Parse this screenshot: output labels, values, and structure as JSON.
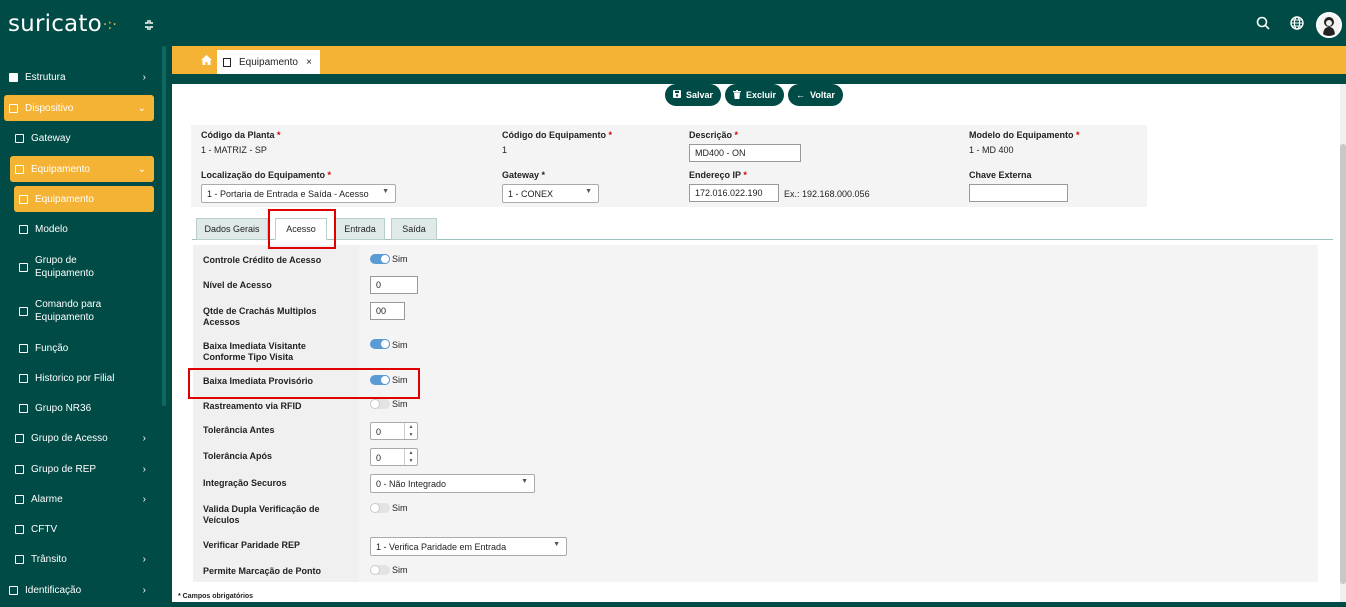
{
  "app": {
    "logo": "suricato",
    "logo_dots": "·:·"
  },
  "sidebar": {
    "items": [
      {
        "label": "Estrutura"
      },
      {
        "label": "Dispositivo"
      },
      {
        "label": "Gateway"
      },
      {
        "label": "Equipamento"
      },
      {
        "label": "Equipamento"
      },
      {
        "label": "Modelo"
      },
      {
        "label": "Grupo de Equipamento"
      },
      {
        "label": "Comando para Equipamento"
      },
      {
        "label": "Função"
      },
      {
        "label": "Historico por Filial"
      },
      {
        "label": "Grupo NR36"
      },
      {
        "label": "Grupo de Acesso"
      },
      {
        "label": "Grupo de REP"
      },
      {
        "label": "Alarme"
      },
      {
        "label": "CFTV"
      },
      {
        "label": "Trânsito"
      },
      {
        "label": "Identificação"
      }
    ]
  },
  "tabbar": {
    "tab_label": "Equipamento",
    "close": "×"
  },
  "toolbar": {
    "save": "Salvar",
    "delete": "Excluir",
    "back": "Voltar"
  },
  "form": {
    "codigo_planta": {
      "label": "Código da Planta",
      "value": "1 - MATRIZ - SP"
    },
    "codigo_equipamento": {
      "label": "Código do Equipamento",
      "value": "1"
    },
    "descricao": {
      "label": "Descrição",
      "value": "MD400 - ON"
    },
    "modelo": {
      "label": "Modelo do Equipamento",
      "value": "1 - MD 400"
    },
    "localizacao": {
      "label": "Localização do Equipamento",
      "value": "1 - Portaria de Entrada e Saída - Acesso"
    },
    "gateway": {
      "label": "Gateway",
      "value": "1 - CONEX"
    },
    "endereco_ip": {
      "label": "Endereço IP",
      "value": "172.016.022.190",
      "hint": "Ex.: 192.168.000.056"
    },
    "chave_externa": {
      "label": "Chave Externa",
      "value": ""
    },
    "required_mark": "*"
  },
  "tabs": [
    {
      "label": "Dados Gerais"
    },
    {
      "label": "Acesso"
    },
    {
      "label": "Entrada"
    },
    {
      "label": "Saída"
    }
  ],
  "acesso": {
    "controle_credito": {
      "label": "Controle Crédito de Acesso",
      "toggle": "Sim",
      "on": true
    },
    "nivel_acesso": {
      "label": "Nível de Acesso",
      "value": "0"
    },
    "qtde_crachas": {
      "label": "Qtde de Crachás Multiplos Acessos",
      "value": "00"
    },
    "baixa_visitante": {
      "label": "Baixa Imediata Visitante Conforme Tipo Visita",
      "toggle": "Sim",
      "on": true
    },
    "baixa_provisorio": {
      "label": "Baixa Imediata Provisório",
      "toggle": "Sim",
      "on": true
    },
    "rastreamento_rfid": {
      "label": "Rastreamento via RFID",
      "toggle": "Sim",
      "on": false
    },
    "tolerancia_antes": {
      "label": "Tolerância Antes",
      "value": "0"
    },
    "tolerancia_apos": {
      "label": "Tolerância Após",
      "value": "0"
    },
    "integracao_securos": {
      "label": "Integração Securos",
      "value": "0 - Não Integrado"
    },
    "valida_dupla": {
      "label": "Valida Dupla Verificação de Veículos",
      "toggle": "Sim",
      "on": false
    },
    "verificar_paridade": {
      "label": "Verificar Paridade REP",
      "value": "1 - Verifica Paridade em Entrada"
    },
    "permite_marcacao": {
      "label": "Permite Marcação de Ponto",
      "toggle": "Sim",
      "on": false
    }
  },
  "footnote": "* Campos obrigatórios",
  "colors": {
    "brand": "#004b45",
    "accent": "#f5b335",
    "highlight": "#e00000"
  }
}
